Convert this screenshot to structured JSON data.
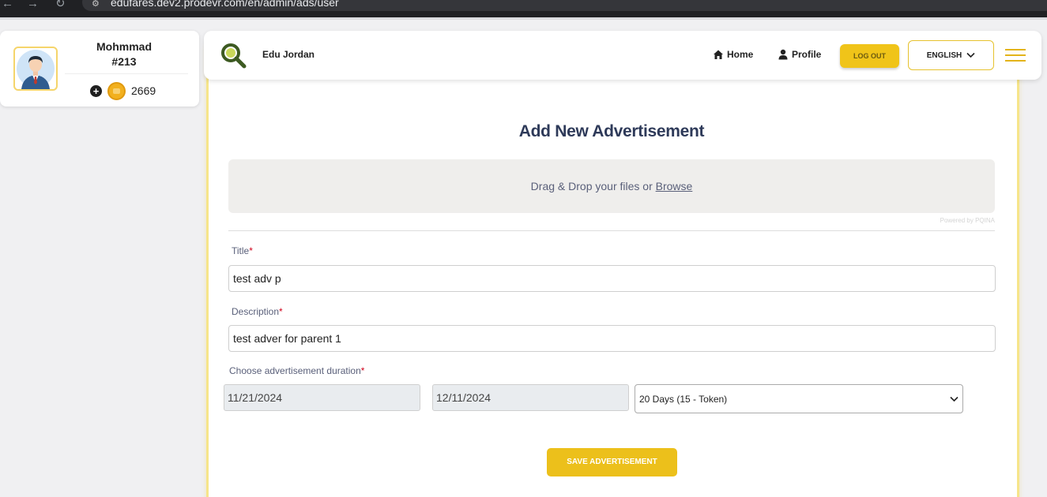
{
  "browser": {
    "url": "edufares.dev2.prodevr.com/en/admin/ads/user"
  },
  "user": {
    "name": "Mohmmad",
    "id": "#213",
    "coins": "2669"
  },
  "header": {
    "brand": "Edu Jordan",
    "home_label": "Home",
    "profile_label": "Profile",
    "logout_label": "LOG OUT",
    "language_label": "ENGLISH"
  },
  "form": {
    "title": "Add New Advertisement",
    "dropzone_text": "Drag & Drop your files or",
    "dropzone_browse": "Browse",
    "powered_by": "Powered by PQINA",
    "title_label": "Title",
    "title_value": "test adv p",
    "description_label": "Description",
    "description_value": "test adver for parent 1",
    "duration_label": "Choose advertisement duration",
    "required_mark": "*",
    "start_date": "11/21/2024",
    "end_date": "12/11/2024",
    "duration_selected": "20 Days (15 - Token)",
    "save_label": "SAVE ADVERTISEMENT"
  },
  "colors": {
    "accent": "#f0c419",
    "title": "#2e3a59",
    "required": "#d0021b"
  },
  "icons": [
    "back-arrow-icon",
    "forward-arrow-icon",
    "reload-icon",
    "site-info-icon",
    "avatar-icon",
    "plus-icon",
    "coin-icon",
    "search-logo-icon",
    "home-icon",
    "user-icon",
    "chevron-down-icon",
    "hamburger-icon"
  ]
}
